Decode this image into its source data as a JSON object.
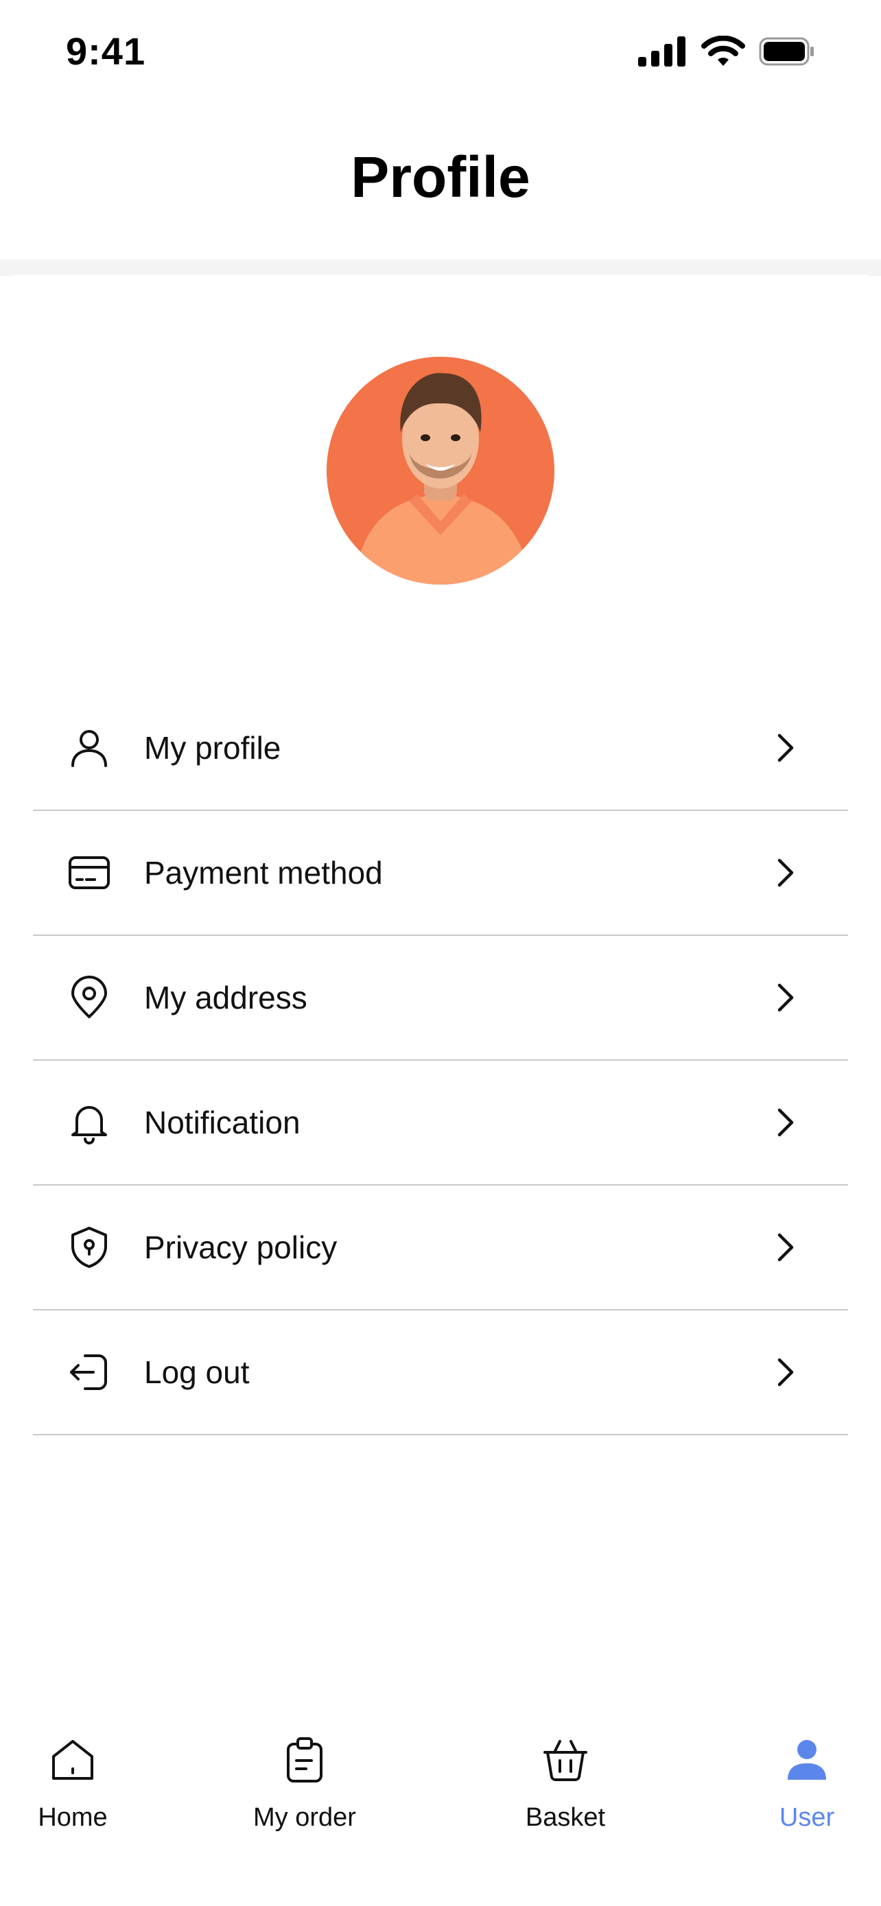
{
  "status_bar": {
    "time": "9:41",
    "icons": [
      "signal-icon",
      "wifi-icon",
      "battery-icon"
    ]
  },
  "header": {
    "title": "Profile"
  },
  "menu": {
    "items": [
      {
        "label": "My profile",
        "icon": "user-icon"
      },
      {
        "label": "Payment method",
        "icon": "card-icon"
      },
      {
        "label": "My address",
        "icon": "location-pin-icon"
      },
      {
        "label": "Notification",
        "icon": "bell-icon"
      },
      {
        "label": "Privacy policy",
        "icon": "shield-icon"
      },
      {
        "label": "Log out",
        "icon": "logout-icon"
      }
    ]
  },
  "bottom_nav": {
    "items": [
      {
        "label": "Home",
        "icon": "home-icon"
      },
      {
        "label": "My order",
        "icon": "clipboard-icon"
      },
      {
        "label": "Basket",
        "icon": "basket-icon"
      },
      {
        "label": "User",
        "icon": "user-filled-icon",
        "active": true
      }
    ],
    "active_color": "#5c87ea"
  },
  "colors": {
    "avatar_background": "#f27448",
    "divider": "#c8c8c8"
  }
}
